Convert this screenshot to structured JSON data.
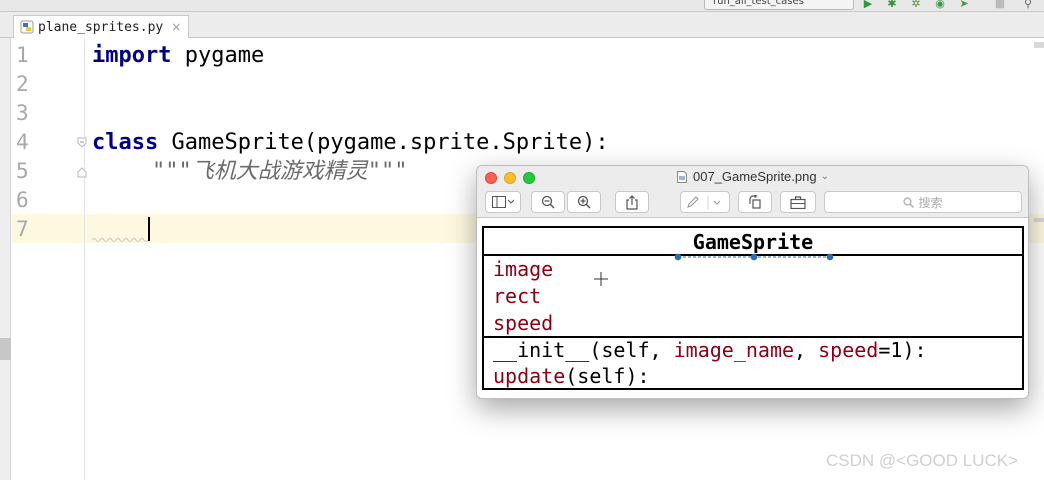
{
  "toolbar": {
    "run_config": "run_all_test_cases",
    "icons": [
      "run-icon",
      "debug-icon",
      "coverage-icon",
      "profile-icon",
      "concurrency-icon",
      "stop-icon",
      "search-icon"
    ]
  },
  "editor": {
    "tab": {
      "filename": "plane_sprites.py",
      "close": "×"
    },
    "lines": [
      {
        "number": "1",
        "keyword": "import",
        "rest": " pygame",
        "doc": ""
      },
      {
        "number": "2",
        "keyword": "",
        "rest": "",
        "doc": ""
      },
      {
        "number": "3",
        "keyword": "",
        "rest": "",
        "doc": ""
      },
      {
        "number": "4",
        "keyword": "class",
        "rest": " GameSprite(pygame.sprite.Sprite):",
        "doc": ""
      },
      {
        "number": "5",
        "keyword": "",
        "rest": "",
        "doc": "\"\"\"飞机大战游戏精灵\"\"\""
      },
      {
        "number": "6",
        "keyword": "",
        "rest": "",
        "doc": ""
      },
      {
        "number": "7",
        "keyword": "",
        "rest": "",
        "doc": ""
      }
    ],
    "current_line": 7
  },
  "preview": {
    "title": "007_GameSprite.png",
    "search_placeholder": "搜索",
    "uml": {
      "class_name": "GameSprite",
      "attributes": [
        "image",
        "rect",
        "speed"
      ],
      "methods": {
        "init": {
          "name": "__init__",
          "open": "(self, ",
          "p1": "image_name",
          "sep": ", ",
          "p2": "speed",
          "tail": "=1):"
        },
        "update": {
          "name": "update",
          "tail": "(self):"
        }
      }
    }
  },
  "colors": {
    "keyword": "#000080",
    "docstring": "#6b6b6b",
    "uml_attribute": "#8b0016",
    "current_line": "#fdf9e1"
  },
  "watermark": "CSDN @<GOOD LUCK>"
}
